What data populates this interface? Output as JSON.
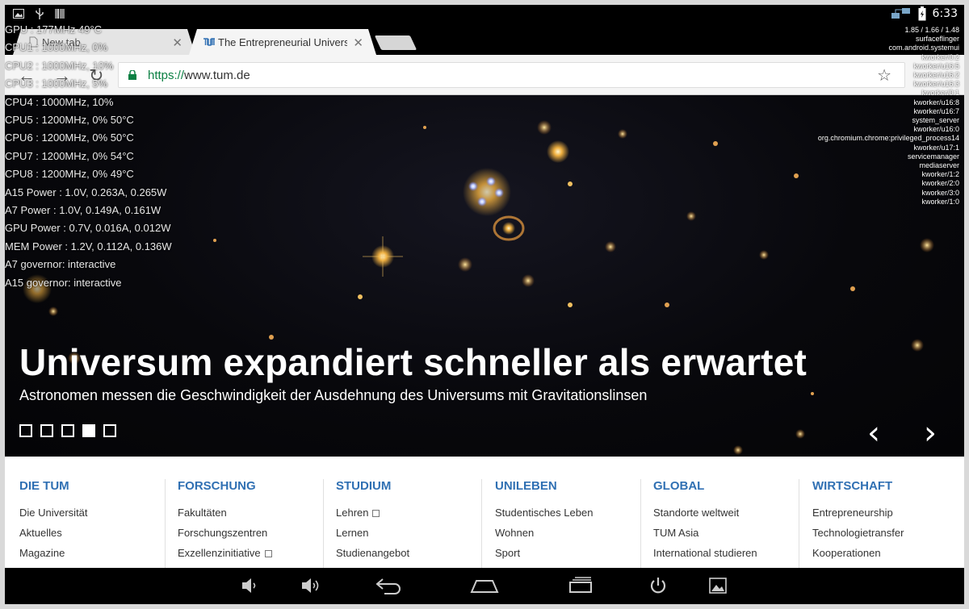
{
  "status_bar": {
    "time": "6:33",
    "icons_left": [
      "gallery-icon",
      "usb-icon",
      "barcode-icon"
    ],
    "icons_right": [
      "network-icon",
      "battery-icon"
    ]
  },
  "tabs": [
    {
      "title": "New tab",
      "active": false,
      "close": "✕"
    },
    {
      "title": "The Entrepreneurial University",
      "active": true,
      "close": "✕"
    }
  ],
  "toolbar": {
    "back": "←",
    "forward": "→",
    "reload": "↻",
    "url_scheme": "https://",
    "url_host": "www.tum.de",
    "star": "☆"
  },
  "overlay_left": [
    "GPU : 177MHz 49°C",
    "CPU1 : 1000MHz, 0%",
    "CPU2 : 1000MHz, 10%",
    "CPU3 : 1000MHz, 5%",
    "CPU4 : 1000MHz, 10%",
    "CPU5 : 1200MHz, 0% 50°C",
    "CPU6 : 1200MHz, 0% 50°C",
    "CPU7 : 1200MHz, 0% 54°C",
    "CPU8 : 1200MHz, 0% 49°C",
    "A15 Power : 1.0V, 0.263A, 0.265W",
    "A7  Power : 1.0V, 0.149A, 0.161W",
    "GPU Power : 0.7V, 0.016A, 0.012W",
    "MEM Power : 1.2V, 0.112A, 0.136W",
    "A7 governor: interactive",
    "A15 governor: interactive"
  ],
  "overlay_right": [
    "1.85 / 1.66 / 1.48",
    "surfaceflinger",
    "com.android.systemui",
    "kworker/0:2",
    "kworker/u16:5",
    "kworker/u16:2",
    "kworker/u16:3",
    "kworker/0:1",
    "kworker/u16:8",
    "kworker/u16:7",
    "system_server",
    "kworker/u16:0",
    "org.chromium.chrome:privileged_process14",
    "kworker/u17:1",
    "servicemanager",
    "mediaserver",
    "kworker/1:2",
    "kworker/2:0",
    "kworker/3:0",
    "kworker/1:0"
  ],
  "hero": {
    "title": "Universum expandiert schneller als erwartet",
    "subtitle": "Astronomen messen die Geschwindigkeit der Ausdehnung des Universums mit Gravitationslinsen",
    "slide_count": 5,
    "active_slide": 4,
    "prev": "‹",
    "next": "›"
  },
  "menu": [
    {
      "heading": "DIE TUM",
      "items": [
        {
          "label": "Die Universität",
          "ext": false
        },
        {
          "label": "Aktuelles",
          "ext": false
        },
        {
          "label": "Magazine",
          "ext": false
        }
      ]
    },
    {
      "heading": "FORSCHUNG",
      "items": [
        {
          "label": "Fakultäten",
          "ext": false
        },
        {
          "label": "Forschungszentren",
          "ext": false
        },
        {
          "label": "Exzellenzinitiative",
          "ext": true
        }
      ]
    },
    {
      "heading": "STUDIUM",
      "items": [
        {
          "label": "Lehren",
          "ext": true
        },
        {
          "label": "Lernen",
          "ext": false
        },
        {
          "label": "Studienangebot",
          "ext": false
        }
      ]
    },
    {
      "heading": "UNILEBEN",
      "items": [
        {
          "label": "Studentisches Leben",
          "ext": false
        },
        {
          "label": "Wohnen",
          "ext": false
        },
        {
          "label": "Sport",
          "ext": false
        }
      ]
    },
    {
      "heading": "GLOBAL",
      "items": [
        {
          "label": "Standorte weltweit",
          "ext": false
        },
        {
          "label": "TUM Asia",
          "ext": false
        },
        {
          "label": "International studieren",
          "ext": false
        }
      ]
    },
    {
      "heading": "WIRTSCHAFT",
      "items": [
        {
          "label": "Entrepreneurship",
          "ext": false
        },
        {
          "label": "Technologietransfer",
          "ext": false
        },
        {
          "label": "Kooperationen",
          "ext": false
        }
      ]
    }
  ],
  "android_nav": [
    "volume-down-icon",
    "volume-up-icon",
    "back-icon",
    "home-icon",
    "recents-icon",
    "power-icon",
    "screenshot-icon"
  ],
  "colors": {
    "link_blue": "#3070b3",
    "https_green": "#0b8043"
  }
}
